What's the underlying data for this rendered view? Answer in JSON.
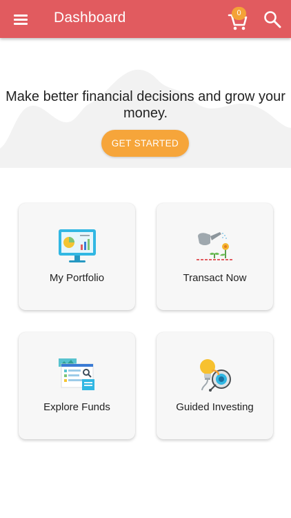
{
  "appbar": {
    "title": "Dashboard",
    "cart_count": "0",
    "color": "#e15b5f",
    "icons": [
      "menu-icon",
      "cart-icon",
      "search-icon"
    ]
  },
  "hero": {
    "headline": "Make better financial decisions and grow your money.",
    "cta_label": "GET STARTED",
    "cta_color": "#f6a53a"
  },
  "tiles": [
    {
      "label": "My Portfolio",
      "icon": "portfolio-monitor-icon"
    },
    {
      "label": "Transact Now",
      "icon": "watering-plant-icon"
    },
    {
      "label": "Explore Funds",
      "icon": "fund-documents-icon"
    },
    {
      "label": "Guided Investing",
      "icon": "bulb-target-icon"
    }
  ]
}
